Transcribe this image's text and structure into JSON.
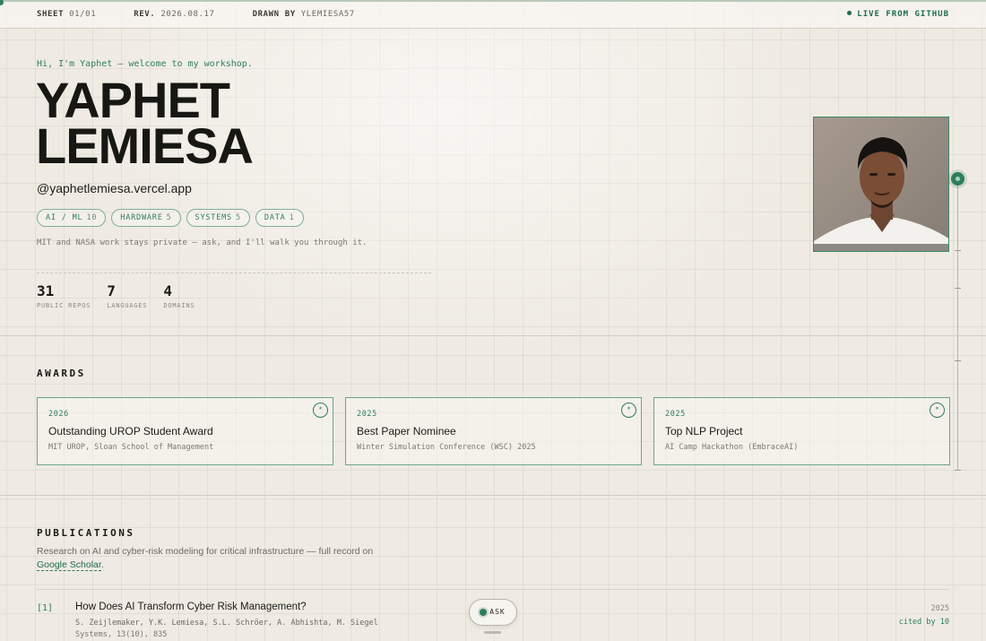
{
  "topbar": {
    "sheet_label": "SHEET",
    "sheet_value": "01/01",
    "rev_label": "REV.",
    "rev_value": "2026.08.17",
    "drawn_label": "DRAWN BY",
    "drawn_value": "YLEMIESA57",
    "live": "LIVE FROM GITHUB"
  },
  "hero": {
    "greeting": "Hi, I'm Yaphet — welcome to my workshop.",
    "first_name": "YAPHET",
    "last_name": "LEMIESA",
    "handle": "@yaphetlemiesa.vercel.app",
    "tags": [
      {
        "label": "AI / ML",
        "count": "10"
      },
      {
        "label": "HARDWARE",
        "count": "5"
      },
      {
        "label": "SYSTEMS",
        "count": "5"
      },
      {
        "label": "DATA",
        "count": "1"
      }
    ],
    "note": "MIT and NASA work stays private — ask, and I'll walk you through it.",
    "stats": [
      {
        "value": "31",
        "label": "PUBLIC REPOS"
      },
      {
        "value": "7",
        "label": "LANGUAGES"
      },
      {
        "value": "4",
        "label": "DOMAINS"
      }
    ]
  },
  "awards": {
    "title": "AWARDS",
    "items": [
      {
        "year": "2026",
        "title": "Outstanding UROP Student Award",
        "subtitle": "MIT UROP, Sloan School of Management",
        "icon": "star-icon"
      },
      {
        "year": "2025",
        "title": "Best Paper Nominee",
        "subtitle": "Winter Simulation Conference (WSC) 2025",
        "icon": "star-icon"
      },
      {
        "year": "2025",
        "title": "Top NLP Project",
        "subtitle": "AI Camp Hackathon (EmbraceAI)",
        "icon": "star-icon"
      }
    ]
  },
  "publications": {
    "title": "PUBLICATIONS",
    "intro": "Research on AI and cyber-risk modeling for critical infrastructure — full record on",
    "scholar_link": "Google Scholar",
    "items": [
      {
        "index": "[1]",
        "title": "How Does AI Transform Cyber Risk Management?",
        "authors": "S. Zeijlemaker, Y.K. Lemiesa, S.L. Schröer, A. Abhishta, M. Siegel",
        "venue": "Systems, 13(10), 835",
        "year": "2025",
        "cited": "cited by 10"
      }
    ]
  },
  "ask_button": "ASK",
  "colors": {
    "accent": "#2f7d5b",
    "background": "#efebe3",
    "ink": "#1a1a16"
  }
}
